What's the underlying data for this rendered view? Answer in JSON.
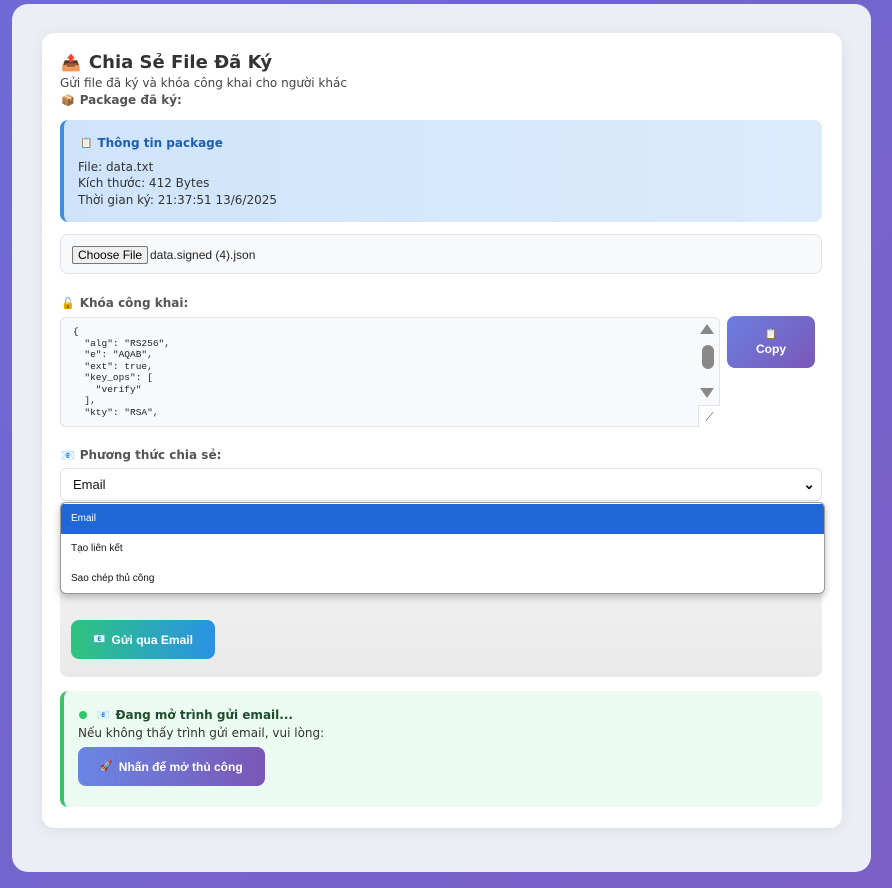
{
  "header": {
    "title": "Chia Sẻ File Đã Ký",
    "title_icon": "📤",
    "subtitle": "Gửi file đã ký và khóa công khai cho người khác"
  },
  "package": {
    "label": "Package đã ký:",
    "label_icon": "📦",
    "info_title": "Thông tin package",
    "info_icon": "📋",
    "file_line": "File: data.txt",
    "size_line": "Kích thước: 412 Bytes",
    "time_line": "Thời gian ký: 21:37:51 13/6/2025"
  },
  "file_input": {
    "button_label": "Choose File",
    "file_name": "data.signed (4).json"
  },
  "public_key": {
    "label": "Khóa công khai:",
    "label_icon": "🔓",
    "content": "{\n  \"alg\": \"RS256\",\n  \"e\": \"AQAB\",\n  \"ext\": true,\n  \"key_ops\": [\n    \"verify\"\n  ],\n  \"kty\": \"RSA\",",
    "copy_icon": "📋",
    "copy_label": "Copy"
  },
  "share_method": {
    "label": "Phương thức chia sẻ:",
    "label_icon": "📧",
    "selected": "Email",
    "options": [
      "Email",
      "Tạo liên kết",
      "Sao chép thủ công"
    ]
  },
  "email_action": {
    "icon": "📧",
    "label": "Gửi qua Email"
  },
  "status": {
    "icon": "📧",
    "title": "Đang mở trình gửi email...",
    "subtitle": "Nếu không thấy trình gửi email, vui lòng:",
    "button_icon": "🚀",
    "button_label": "Nhấn để mở thủ công",
    "dot_color": "#2fc767"
  }
}
